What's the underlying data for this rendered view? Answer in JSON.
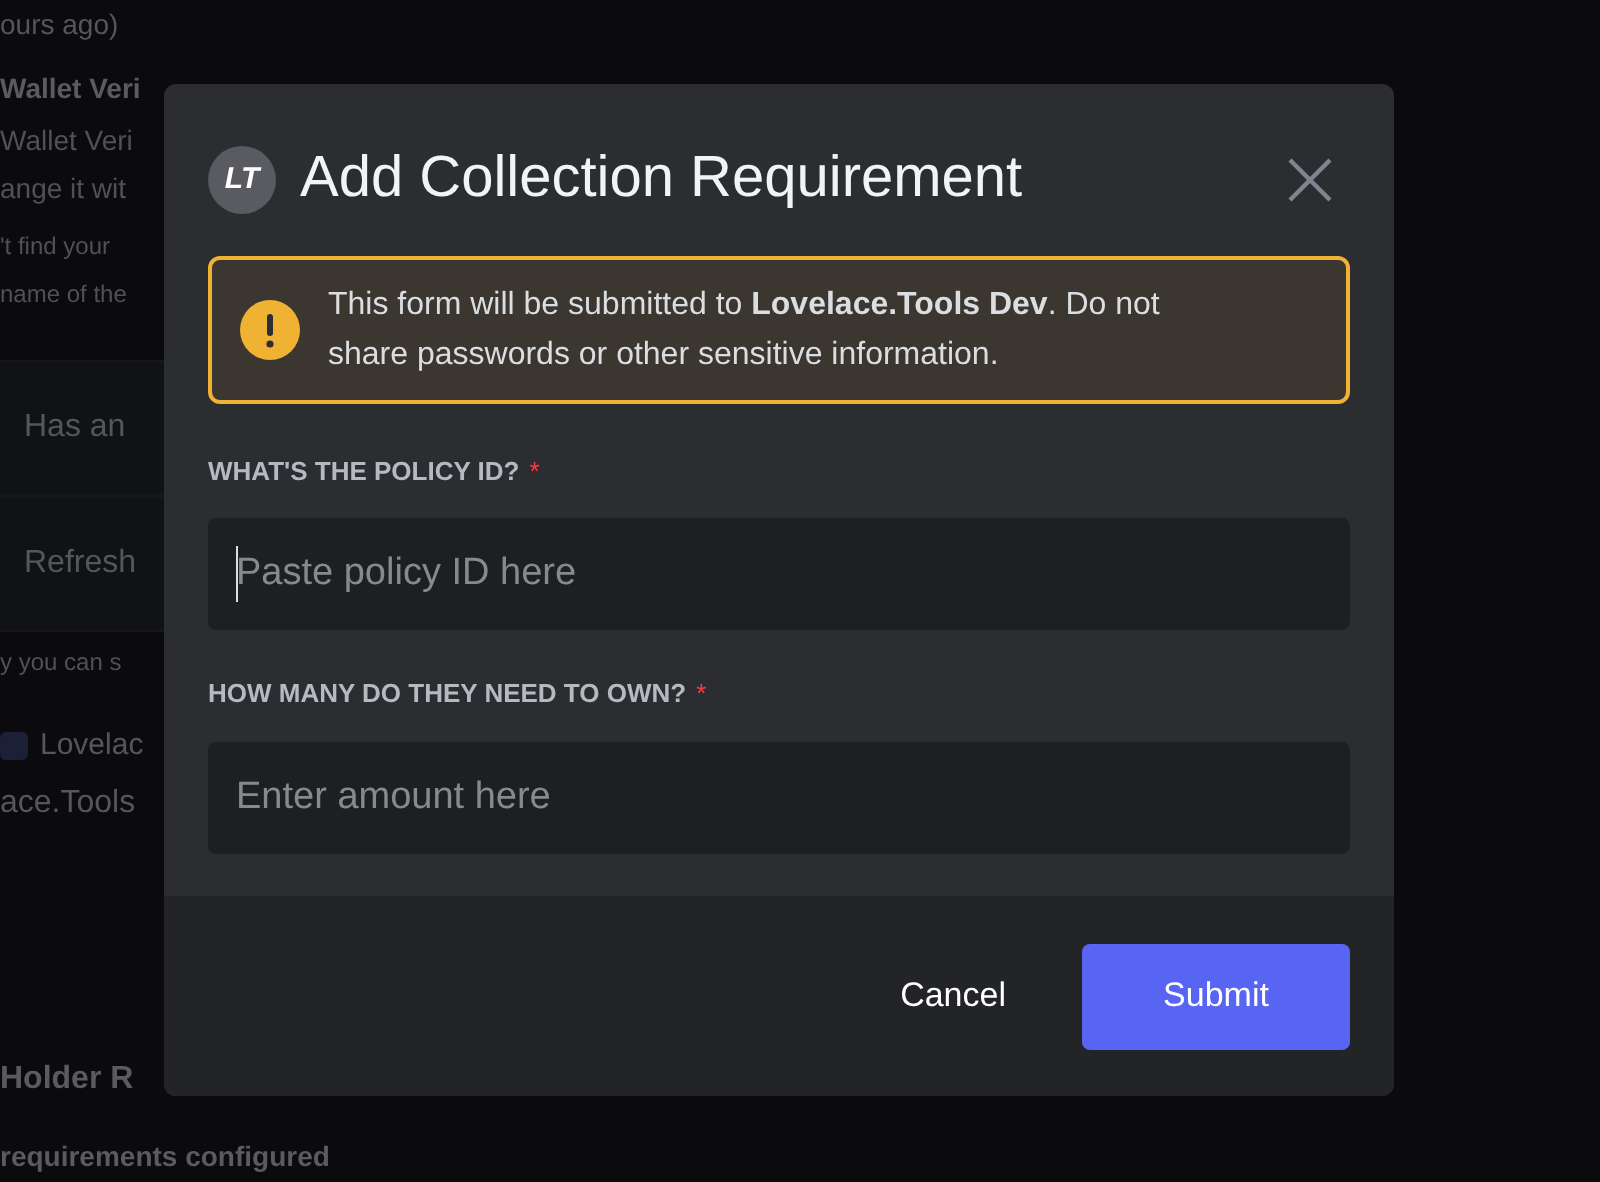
{
  "background": {
    "lines": [
      {
        "kind": "muted",
        "text": "ours ago)"
      },
      {
        "kind": "heading",
        "text": "Wallet Veri"
      },
      {
        "kind": "body",
        "text": "Wallet Veri"
      },
      {
        "kind": "body",
        "text": "ange it wit"
      },
      {
        "kind": "small",
        "text": "'t find your"
      },
      {
        "kind": "small",
        "text": "name of the"
      },
      {
        "kind": "band",
        "text": "Has an"
      },
      {
        "kind": "band",
        "text": "Refresh"
      },
      {
        "kind": "small",
        "text": "y you can s"
      },
      {
        "kind": "app",
        "text": "Lovelac"
      },
      {
        "kind": "large",
        "text": "ace.Tools"
      },
      {
        "kind": "title",
        "text": "Holder R"
      },
      {
        "kind": "heading",
        "text": "requirements configured"
      }
    ]
  },
  "modal": {
    "logo": "LT",
    "title": "Add Collection Requirement",
    "notice": "This form will be submitted to **Lovelace.Tools Dev**. Do not share passwords or other sensitive information.",
    "fields": [
      {
        "label": "WHAT'S THE POLICY ID?",
        "required_mark": "*",
        "placeholder": "Paste policy ID here",
        "focused": true
      },
      {
        "label": "HOW MANY DO THEY NEED TO OWN?",
        "required_mark": "*",
        "placeholder": "Enter amount here",
        "focused": false
      }
    ],
    "buttons": [
      {
        "kind": "secondary",
        "label": "Cancel"
      },
      {
        "kind": "primary",
        "label": "Submit"
      }
    ]
  }
}
